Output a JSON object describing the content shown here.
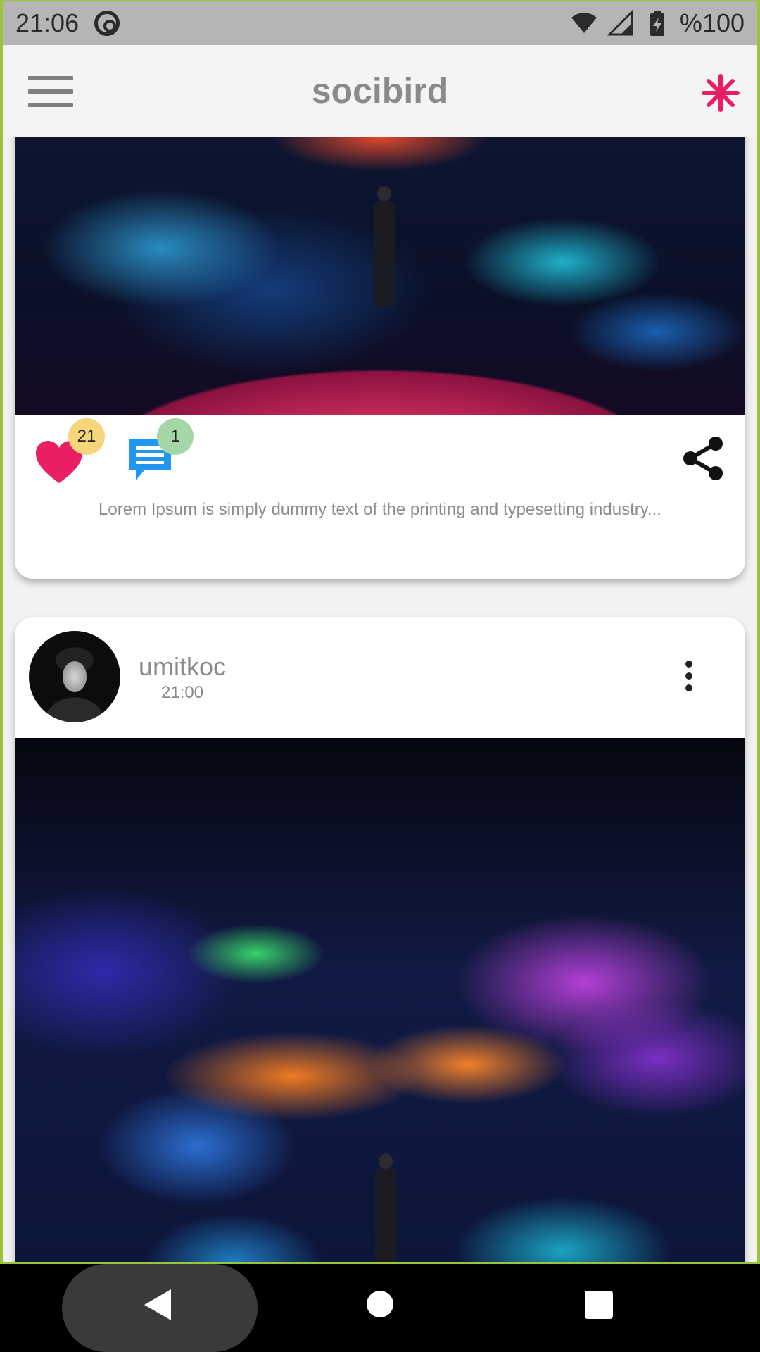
{
  "status_bar": {
    "time": "21:06",
    "battery": "%100",
    "icons": [
      "at-sign-icon",
      "wifi-icon",
      "signal-icon",
      "battery-charging-icon"
    ]
  },
  "app_bar": {
    "title": "socibird",
    "menu_icon": "hamburger-menu-icon",
    "action_icon": "snowflake-icon",
    "accent_color": "#e91e63"
  },
  "posts": [
    {
      "likes": "21",
      "comments": "1",
      "caption": "Lorem Ipsum is simply dummy text of the printing and typesetting industry..."
    },
    {
      "username": "umitkoc",
      "time": "21:00"
    }
  ],
  "colors": {
    "heart": "#e91e63",
    "chat": "#2196f3",
    "likes_badge": "#f7d57a",
    "comments_badge": "#a5d6a7",
    "frame": "#9ac43a"
  },
  "nav_bar": {
    "icons": [
      "back-icon",
      "home-icon",
      "recent-apps-icon"
    ]
  }
}
